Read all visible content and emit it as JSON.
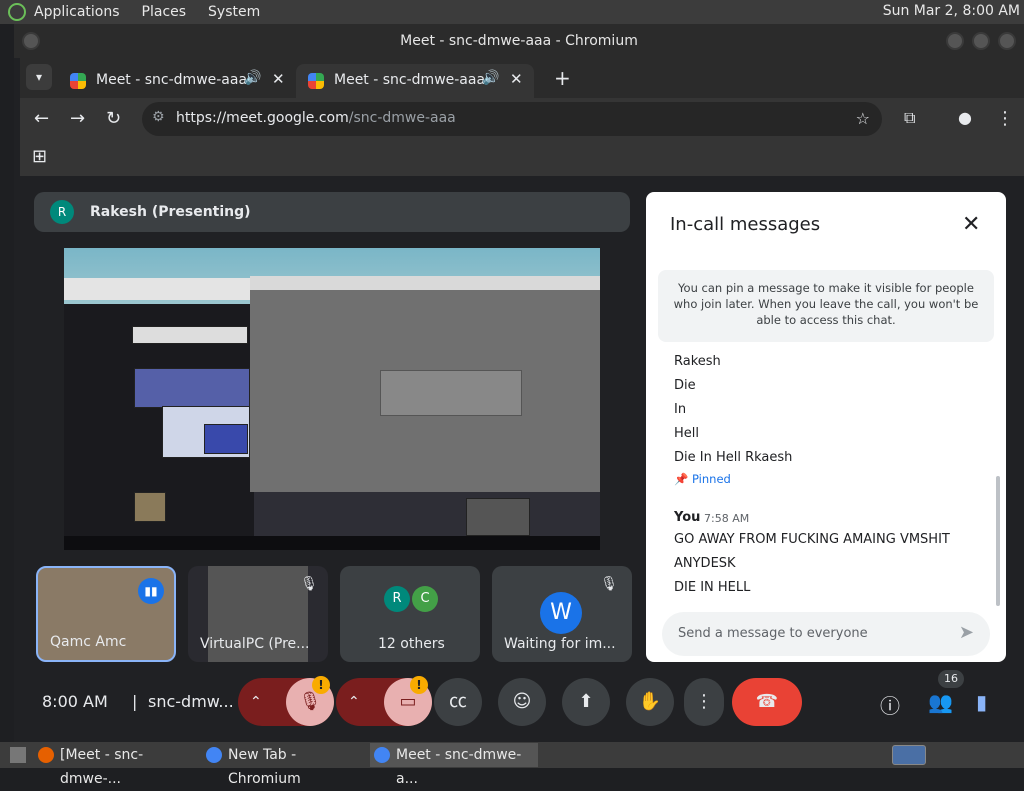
{
  "system_panel": {
    "menus": [
      "Applications",
      "Places",
      "System"
    ],
    "clock": "Sun Mar 2, 8:00 AM"
  },
  "window": {
    "title": "Meet - snc-dmwe-aaa - Chromium"
  },
  "tabs": [
    {
      "label": "Meet - snc-dmwe-aaa",
      "sound_icon": "🔊",
      "close_icon": "✕"
    },
    {
      "label": "Meet - snc-dmwe-aaa",
      "sound_icon": "🔊",
      "close_icon": "✕"
    }
  ],
  "new_tab_icon": "+",
  "toolbar": {
    "url_host": "https://meet.google.com",
    "url_path": "/snc-dmwe-aaa"
  },
  "meet": {
    "presenter_initial": "R",
    "presenter_label": "Rakesh (Presenting)",
    "tiles": [
      {
        "label": "Qamc Amc"
      },
      {
        "label": "VirtualPC (Pre..."
      },
      {
        "label": "12 others",
        "initials": [
          "R",
          "C"
        ]
      },
      {
        "label": "Waiting for im...",
        "initial": "W"
      }
    ],
    "clock": "8:00 AM",
    "separator": "|",
    "meeting_code": "snc-dmw...",
    "participants_count": "16",
    "warning_mark": "!"
  },
  "chat": {
    "title": "In-call messages",
    "close_icon": "✕",
    "note": "You can pin a message to make it visible for people who join later. When you leave the call, you won't be able to access this chat.",
    "messages_before": [
      "Rakesh",
      "Die",
      "In",
      "Hell",
      "Die In Hell Rkaesh"
    ],
    "pinned_label": "Pinned",
    "sender": "You",
    "time": "7:58 AM",
    "messages_after": [
      "GO AWAY FROM FUCKING AMAING VMSHIT",
      "ANYDESK",
      "DIE IN HELL"
    ],
    "input_placeholder": "Send a message to everyone"
  },
  "taskbar": [
    {
      "label": "[Meet - snc-dmwe-..."
    },
    {
      "label": "New Tab - Chromium"
    },
    {
      "label": "Meet - snc-dmwe-a..."
    }
  ],
  "colors": {
    "end_call": "#e94235",
    "muted_red": "#7a1e1e",
    "warning": "#f9ab00",
    "chat_accent": "#1a73e8"
  }
}
